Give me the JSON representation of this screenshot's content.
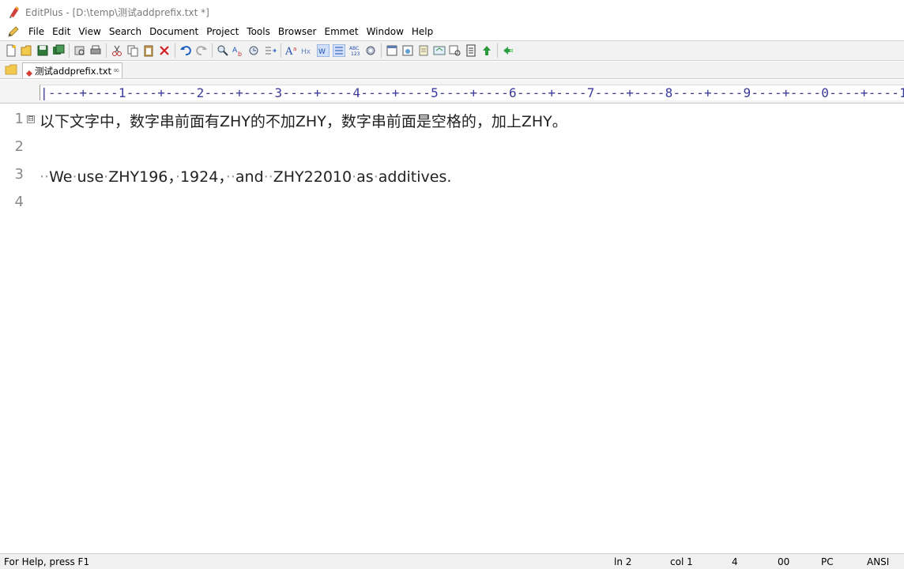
{
  "window": {
    "title": "EditPlus - [D:\\temp\\测试addprefix.txt *]"
  },
  "menu": [
    "File",
    "Edit",
    "View",
    "Search",
    "Document",
    "Project",
    "Tools",
    "Browser",
    "Emmet",
    "Window",
    "Help"
  ],
  "toolbar": {
    "buttons": [
      [
        "new-file-icon",
        "open-folder-icon",
        "save-icon",
        "save-all-icon"
      ],
      [
        "print-preview-icon",
        "print-icon"
      ],
      [
        "cut-icon",
        "copy-icon",
        "paste-icon",
        "delete-icon"
      ],
      [
        "undo-icon",
        "redo-icon"
      ],
      [
        "find-icon",
        "replace-icon",
        "goto-icon",
        "insert-icon"
      ],
      [
        "font-size-icon",
        "hex-view-icon",
        "word-wrap-icon",
        "line-number-icon",
        "spell-check-icon",
        "settings-gear-icon"
      ],
      [
        "window-icon",
        "browser-preview-icon",
        "cliptext-icon",
        "directory-icon",
        "search-files-icon",
        "ftp-icon",
        "upload-icon"
      ],
      [
        "run-icon"
      ]
    ]
  },
  "tabs": [
    {
      "label": "测试addprefix.txt",
      "modified": true,
      "close": "∞"
    }
  ],
  "ruler": {
    "text": "|----+----1----+----2----+----3----+----4----+----5----+----6----+----7----+----8----+----9----+----0----+----1"
  },
  "editor": {
    "lines": [
      {
        "num": "1",
        "fold": "⊟",
        "segments": [
          {
            "t": "以下文字中，数字串前面有ZHY的不加ZHY，数字串前面是空格的，加上ZHY。",
            "ws": false
          }
        ]
      },
      {
        "num": "2",
        "segments": []
      },
      {
        "num": "3",
        "segments": [
          {
            "t": "··",
            "ws": true
          },
          {
            "t": "We",
            "ws": false
          },
          {
            "t": "·",
            "ws": true
          },
          {
            "t": "use",
            "ws": false
          },
          {
            "t": "·",
            "ws": true
          },
          {
            "t": "ZHY196，",
            "ws": false
          },
          {
            "t": "·",
            "ws": true
          },
          {
            "t": "1924，",
            "ws": false
          },
          {
            "t": "··",
            "ws": true
          },
          {
            "t": "and",
            "ws": false
          },
          {
            "t": "··",
            "ws": true
          },
          {
            "t": "ZHY22010",
            "ws": false
          },
          {
            "t": "·",
            "ws": true
          },
          {
            "t": "as",
            "ws": false
          },
          {
            "t": "·",
            "ws": true
          },
          {
            "t": "additives.",
            "ws": false
          }
        ]
      },
      {
        "num": "4",
        "segments": []
      }
    ]
  },
  "status": {
    "help": "For Help, press F1",
    "line": "ln 2",
    "col": "col 1",
    "count": "4",
    "code": "00",
    "mode": "PC",
    "encoding": "ANSI"
  },
  "colors": {
    "ruler_text": "#3b3b9b",
    "toolbar_bg": "#f2f2f2",
    "whitespace_dot": "#9a9a9a"
  }
}
